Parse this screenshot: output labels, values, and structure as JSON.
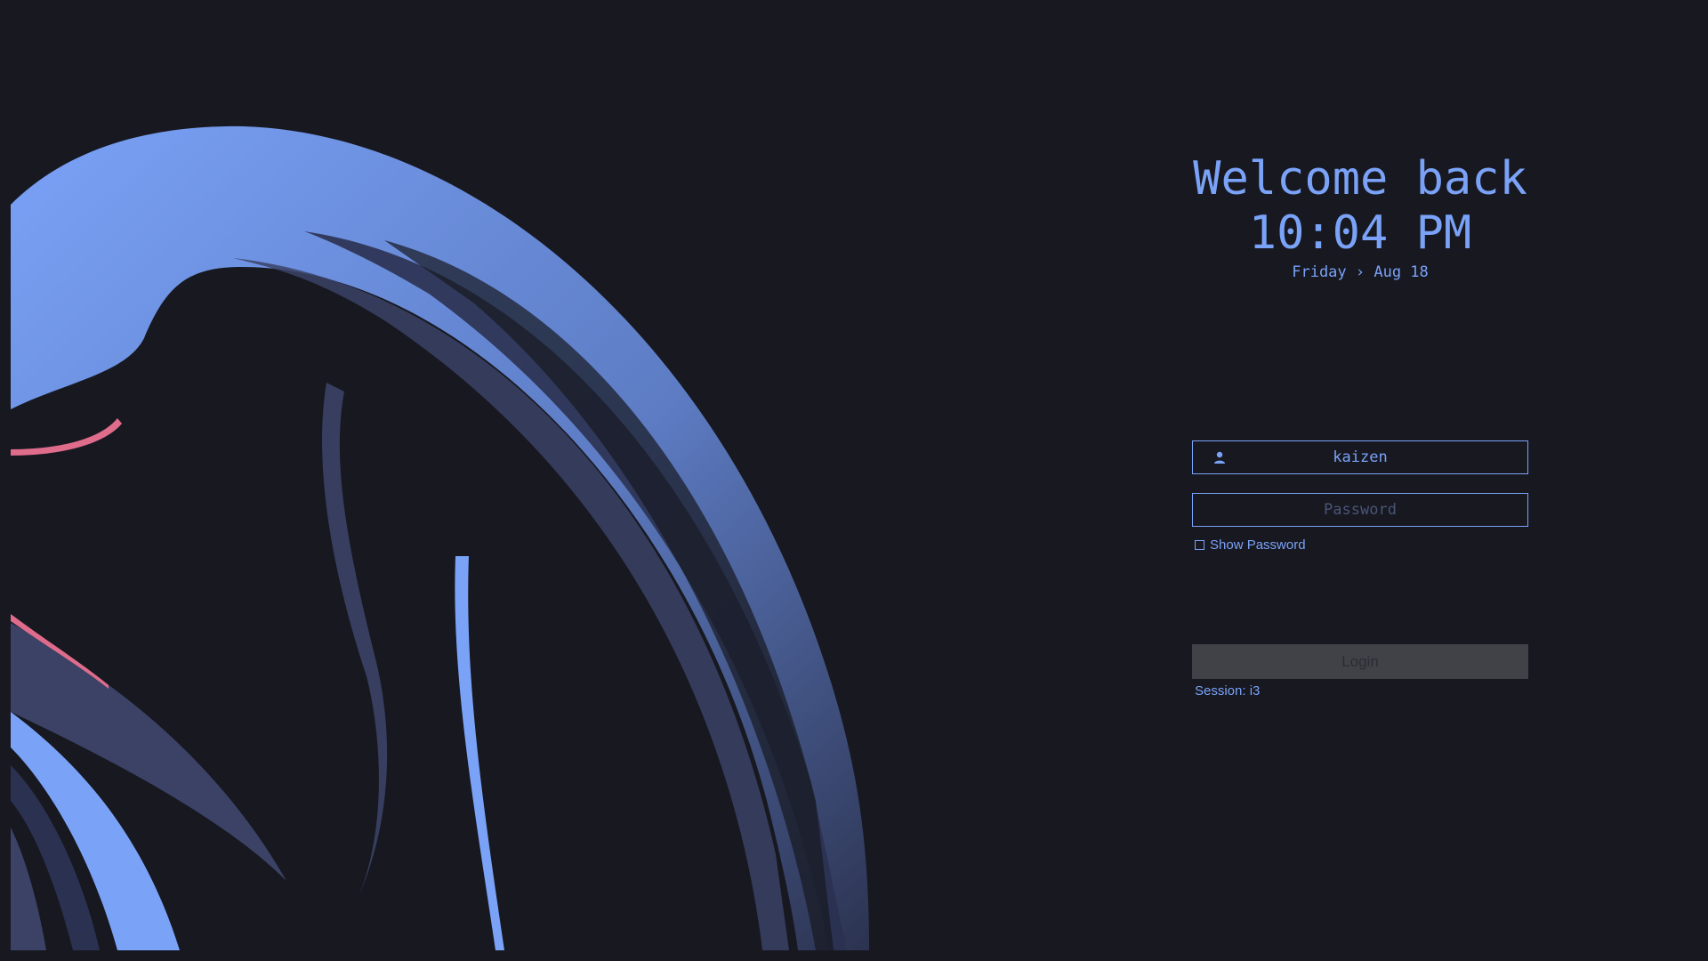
{
  "greeter": {
    "welcome": "Welcome back",
    "time": "10:04 PM",
    "date": "Friday › Aug 18"
  },
  "login_form": {
    "username_value": "kaizen",
    "password_placeholder": "Password",
    "show_password_label": "Show Password",
    "show_password_checked": false,
    "login_button_label": "Login",
    "session_label": "Session: i3"
  },
  "icons": {
    "user_field": "user-icon"
  },
  "colors": {
    "background": "#171820",
    "accent": "#7aa2f7",
    "wallpaper_dark": "#262b40",
    "wallpaper_mid": "#3b4266",
    "wallpaper_pink": "#e06c8c",
    "button_disabled": "#414248"
  }
}
